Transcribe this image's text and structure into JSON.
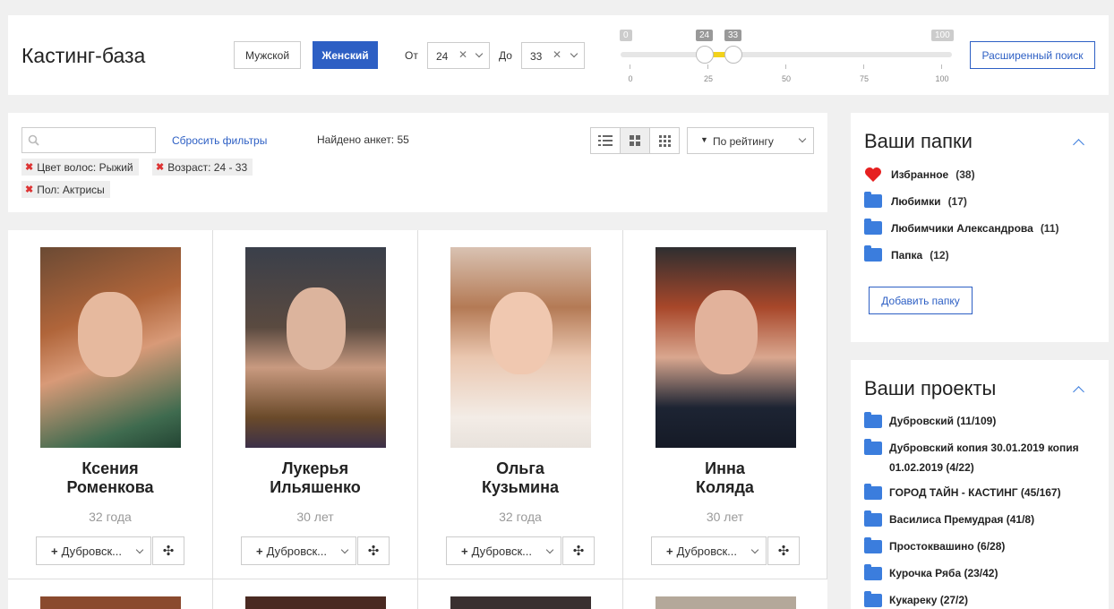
{
  "header": {
    "title": "Кастинг-база",
    "gender_male": "Мужской",
    "gender_female": "Женский",
    "from_label": "От",
    "from_value": "24",
    "to_label": "До",
    "to_value": "33",
    "slider": {
      "min": 0,
      "max": 100,
      "low": 24,
      "high": 33,
      "min_label": "0",
      "max_label": "100",
      "low_label": "24",
      "high_label": "33",
      "ticks": [
        "0",
        "25",
        "50",
        "75",
        "100"
      ]
    },
    "advanced_search": "Расширенный поиск",
    "accent_color": "#2d5fc4"
  },
  "filters": {
    "search_placeholder": "",
    "reset": "Сбросить фильтры",
    "found": "Найдено анкет: 55",
    "sort": "По рейтингу",
    "chips": [
      "Цвет волос:  Рыжий",
      "Возраст:  24 - 33",
      "Пол:  Актрисы"
    ]
  },
  "cards": [
    {
      "name1": "Ксения",
      "name2": "Роменкова",
      "age": "32 года",
      "project": "Дубровск..."
    },
    {
      "name1": "Лукерья",
      "name2": "Ильяшенко",
      "age": "30 лет",
      "project": "Дубровск..."
    },
    {
      "name1": "Ольга",
      "name2": "Кузьмина",
      "age": "32 года",
      "project": "Дубровск..."
    },
    {
      "name1": "Инна",
      "name2": "Коляда",
      "age": "30 лет",
      "project": "Дубровск..."
    }
  ],
  "folders": {
    "title": "Ваши папки",
    "items": [
      {
        "label": "Избранное",
        "count": "(38)"
      },
      {
        "label": "Любимки",
        "count": "(17)"
      },
      {
        "label": "Любимчики Александрова",
        "count": "(11)"
      },
      {
        "label": "Папка",
        "count": "(12)"
      }
    ],
    "add": "Добавить папку"
  },
  "projects": {
    "title": "Ваши проекты",
    "items": [
      "Дубровский (11/109)",
      "Дубровский копия 30.01.2019 копия 01.02.2019 (4/22)",
      "ГОРОД ТАЙН - КАСТИНГ (45/167)",
      "Василиса Премудрая (41/8)",
      "Простоквашино (6/28)",
      "Курочка Ряба (23/42)",
      "Кукареку (27/2)"
    ]
  }
}
